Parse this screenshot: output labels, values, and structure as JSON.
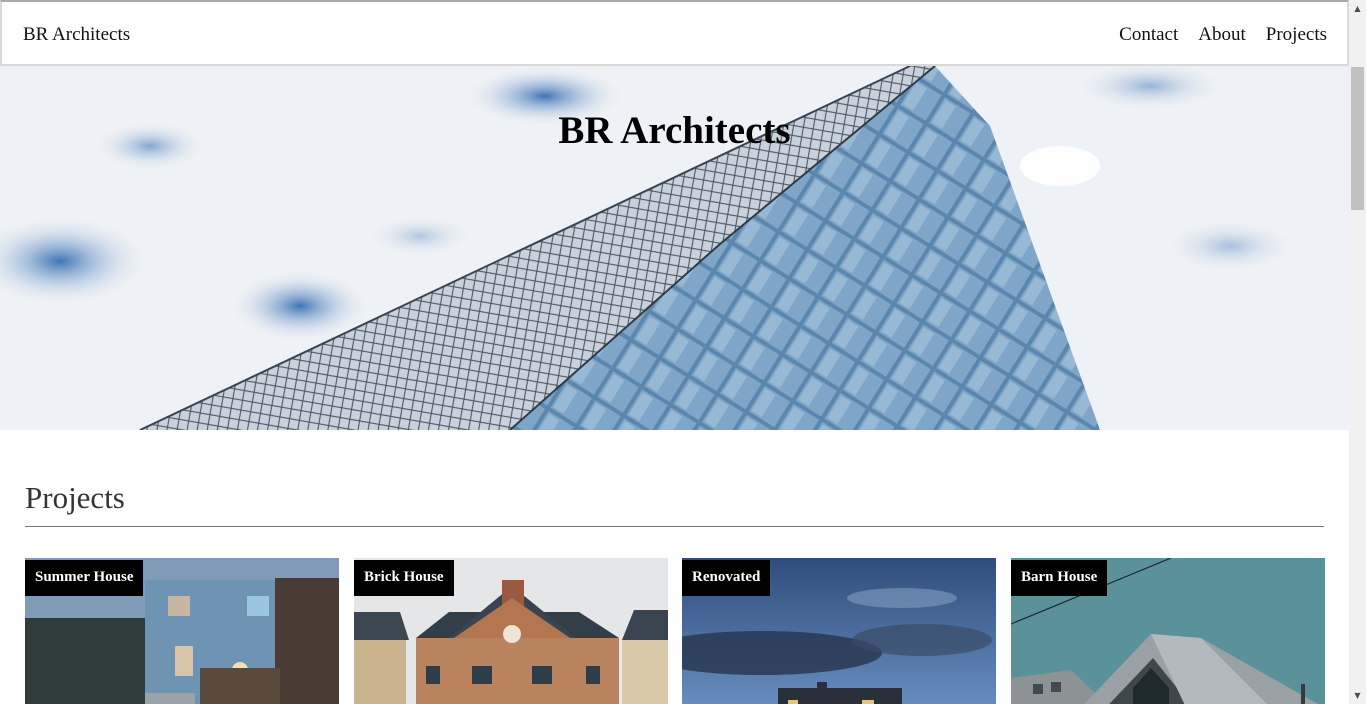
{
  "navbar": {
    "brand": "BR Architects",
    "links": [
      "Contact",
      "About",
      "Projects"
    ]
  },
  "hero": {
    "title": "BR Architects",
    "image": "glass-skyscraper-against-cloudy-sky"
  },
  "projects": {
    "heading": "Projects",
    "cards": [
      {
        "tag": "Summer House",
        "image": "blue-shingle-house-with-reeds"
      },
      {
        "tag": "Brick House",
        "image": "red-brick-terraced-houses"
      },
      {
        "tag": "Renovated",
        "image": "house-under-dusk-sky"
      },
      {
        "tag": "Barn House",
        "image": "modern-barn-roof-teal-sky"
      }
    ]
  },
  "colors": {
    "tag_bg": "#000000",
    "rule": "#777777",
    "scrollbar_track": "#f1f1f1",
    "scrollbar_thumb": "#c1c1c1"
  }
}
